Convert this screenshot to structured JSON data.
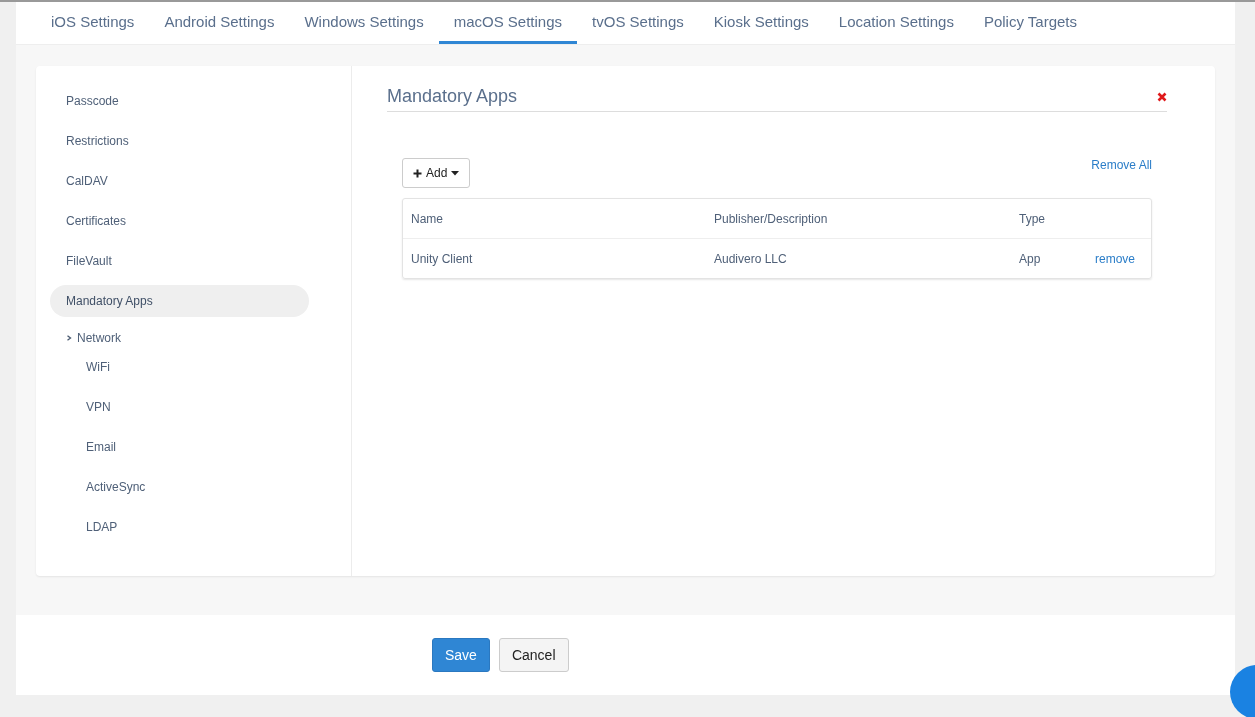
{
  "tabs": [
    {
      "label": "iOS Settings",
      "selected": false
    },
    {
      "label": "Android Settings",
      "selected": false
    },
    {
      "label": "Windows Settings",
      "selected": false
    },
    {
      "label": "macOS Settings",
      "selected": true
    },
    {
      "label": "tvOS Settings",
      "selected": false
    },
    {
      "label": "Kiosk Settings",
      "selected": false
    },
    {
      "label": "Location Settings",
      "selected": false
    },
    {
      "label": "Policy Targets",
      "selected": false
    }
  ],
  "sidebar": {
    "items": [
      {
        "label": "Passcode",
        "selected": false
      },
      {
        "label": "Restrictions",
        "selected": false
      },
      {
        "label": "CalDAV",
        "selected": false
      },
      {
        "label": "Certificates",
        "selected": false
      },
      {
        "label": "FileVault",
        "selected": false
      },
      {
        "label": "Mandatory Apps",
        "selected": true
      },
      {
        "label": "Network",
        "selected": false,
        "expanded": true,
        "children": [
          {
            "label": "WiFi",
            "selected": false
          },
          {
            "label": "VPN",
            "selected": false
          },
          {
            "label": "Email",
            "selected": false
          },
          {
            "label": "ActiveSync",
            "selected": false
          },
          {
            "label": "LDAP",
            "selected": false
          }
        ]
      }
    ]
  },
  "section": {
    "title": "Mandatory Apps",
    "add_button": "Add",
    "remove_all": "Remove All",
    "table": {
      "columns": [
        "Name",
        "Publisher/Description",
        "Type"
      ],
      "rows": [
        {
          "cells": [
            "Unity Client",
            "Audivero LLC",
            "App"
          ],
          "action": "remove"
        }
      ]
    }
  },
  "footer": {
    "buttons": [
      {
        "label": "Save",
        "kind": "primary"
      },
      {
        "label": "Cancel",
        "kind": "default"
      }
    ]
  }
}
